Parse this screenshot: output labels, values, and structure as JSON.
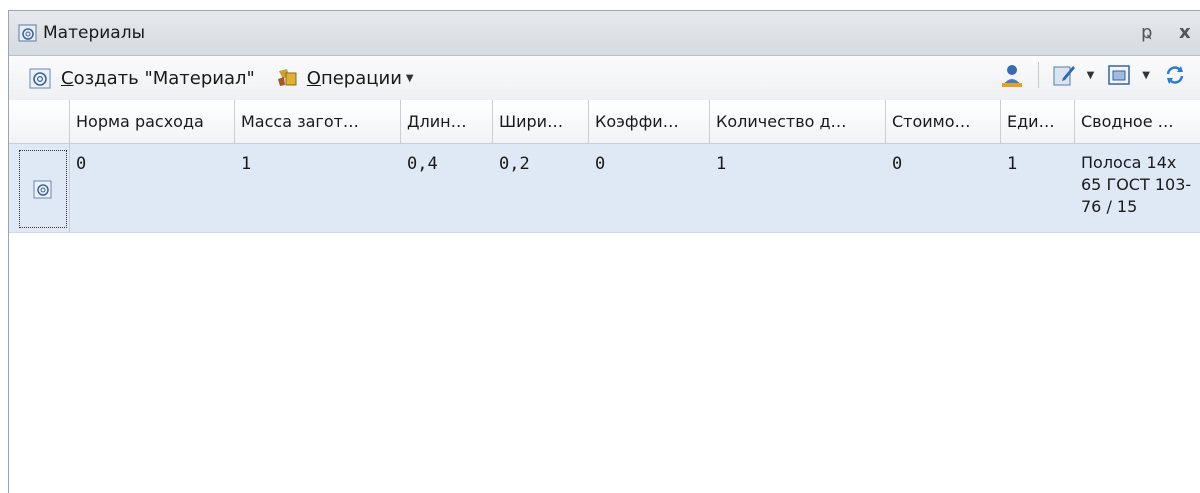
{
  "window": {
    "title": "Материалы",
    "pin_glyph": "ҏ",
    "close_glyph": "x"
  },
  "toolbar": {
    "create_prefix": "",
    "create_label_underlined": "С",
    "create_label_rest": "оздать \"Материал\"",
    "operations_underlined": "О",
    "operations_rest": "перации"
  },
  "table": {
    "columns": [
      "Норма расхода",
      "Масса загот…",
      "Длин…",
      "Шири…",
      "Коэффи…",
      "Количество д…",
      "Стоимо…",
      "Еди…",
      "Сводное …"
    ],
    "rows": [
      {
        "values": [
          "0",
          "1",
          "0,4",
          "0,2",
          "0",
          "1",
          "0",
          "1"
        ],
        "summary": "Полоса 14х 65 ГОСТ 103-76 / 15"
      }
    ]
  },
  "icons": {
    "title": "material-icon",
    "create": "material-icon",
    "operations": "operations-icon",
    "user": "user-icon",
    "edit": "edit-icon",
    "view": "view-icon",
    "refresh": "refresh-icon"
  }
}
